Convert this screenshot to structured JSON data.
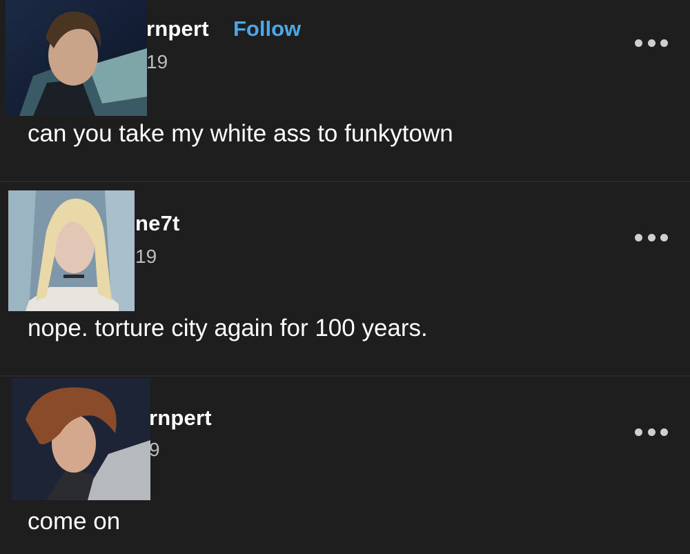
{
  "posts": [
    {
      "username": "rnpert",
      "follow_label": "Follow",
      "date": "19",
      "text": "can you take my white ass to funkytown",
      "avatar_icon": "avatar-dark-haired-man"
    },
    {
      "username": "ne7t",
      "date": "19",
      "text": "nope. torture city again for 100 years.",
      "avatar_icon": "avatar-blonde-woman"
    },
    {
      "username": "rnpert",
      "date": "9",
      "text": "come on",
      "avatar_icon": "avatar-brown-haired-man"
    }
  ],
  "colors": {
    "background": "#1e1e1f",
    "follow": "#4aa8e6",
    "divider": "#2a2a2b"
  },
  "icons": {
    "more": "more-options-icon"
  }
}
